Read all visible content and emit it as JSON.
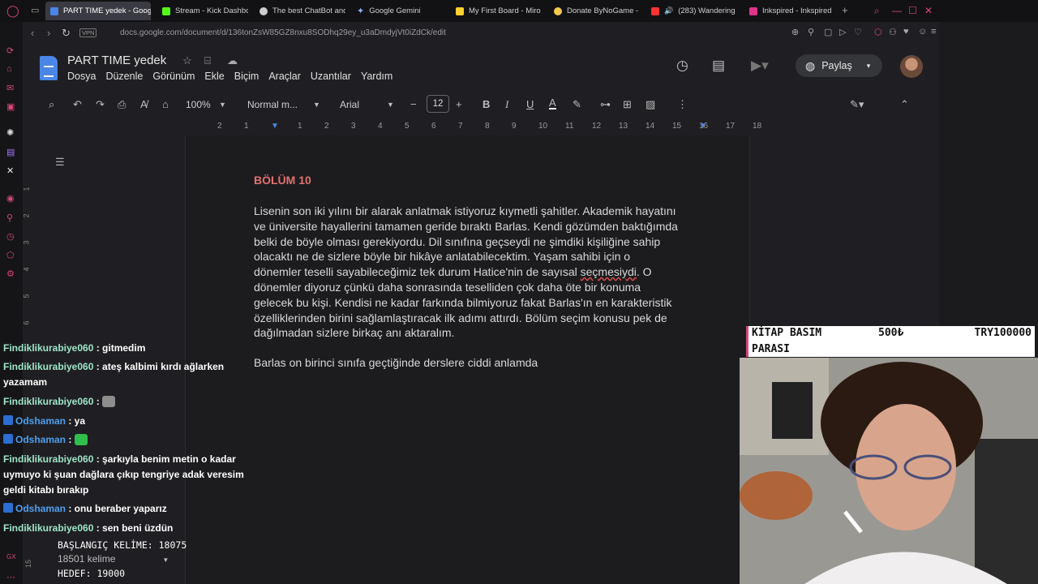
{
  "tabs": [
    {
      "label": "PART TIME yedek - Goog",
      "active": true,
      "color": "#4a86e8"
    },
    {
      "label": "Stream - Kick Dashbo",
      "active": false,
      "color": "#53fc18"
    },
    {
      "label": "The best ChatBot and",
      "active": false,
      "color": "#cccccc"
    },
    {
      "label": "Google Gemini",
      "active": false,
      "color": "#8ab4f8"
    },
    {
      "label": "My First Board - Miro",
      "active": false,
      "color": "#ffd02f"
    },
    {
      "label": "Donate ByNoGame - ",
      "active": false,
      "color": "#f2c94c"
    },
    {
      "label": "(283) Wandering",
      "active": false,
      "color": "#ff3333"
    },
    {
      "label": "Inkspired - Inkspired",
      "active": false,
      "color": "#e0348a"
    }
  ],
  "address": {
    "vpn": "VPN",
    "url": "docs.google.com/document/d/136tonZsW85GZ8nxu8SODhq29ey_u3aDmdyjVt0iZdCk/edit"
  },
  "docs": {
    "title": "PART TIME  yedek",
    "menu": [
      "Dosya",
      "Düzenle",
      "Görünüm",
      "Ekle",
      "Biçim",
      "Araçlar",
      "Uzantılar",
      "Yardım"
    ],
    "share_label": "Paylaş",
    "toolbar": {
      "zoom": "100%",
      "style": "Normal m...",
      "font": "Arial",
      "font_size": "12"
    },
    "ruler_numbers": [
      "2",
      "1",
      "",
      "1",
      "2",
      "3",
      "4",
      "5",
      "6",
      "7",
      "8",
      "9",
      "10",
      "11",
      "12",
      "13",
      "14",
      "15",
      "16",
      "17",
      "18"
    ],
    "vruler_numbers": [
      "1",
      "2",
      "3",
      "4",
      "5",
      "6",
      "15"
    ]
  },
  "document": {
    "chapter": "BÖLÜM 10",
    "paragraph1_lines": [
      "Lisenin son iki yılını bir alarak anlatmak istiyoruz kıymetli şahitler. Akademik hayatını",
      "ve üniversite hayallerini tamamen geride bıraktı Barlas. Kendi gözümden baktığımda",
      "belki de böyle olması gerekiyordu. Dil sınıfına geçseydi ne şimdiki kişiliğine sahip",
      "olacaktı ne de sizlere böyle bir hikâye anlatabilecektim. Yaşam sahibi için o",
      "dönemler teselli sayabileceğimiz tek durum Hatice'nin de sayısal ",
      "dönemler diyoruz çünkü daha sonrasında teselliden çok daha öte bir konuma",
      "gelecek bu kişi. Kendisi ne kadar farkında bilmiyoruz fakat Barlas'ın en karakteristik",
      "özelliklerinden birini sağlamlaştıracak ilk adımı attırdı. Bölüm seçim konusu pek de",
      "dağılmadan sizlere birkaç anı aktaralım."
    ],
    "misspelled": "seçmesiydi",
    "after_misspelled": ". O",
    "paragraph2": "Barlas on birinci sınıfa geçtiğinde derslere ciddi anlamda"
  },
  "chat": [
    {
      "user": "Findiklikurabiye060",
      "text": " : gitmedim",
      "style": "green",
      "badge": false
    },
    {
      "user": "Findiklikurabiye060",
      "text": " : ateş kalbimi kırdı ağlarken yazamam",
      "style": "green",
      "badge": false
    },
    {
      "user": "Findiklikurabiye060",
      "text": " : ",
      "style": "green",
      "badge": false,
      "emote": "cat-emote"
    },
    {
      "user": "Odshaman",
      "text": " : ya",
      "style": "blue",
      "badge": true
    },
    {
      "user": "Odshaman",
      "text": " : ",
      "style": "blue",
      "badge": true,
      "emote": "green-emote"
    },
    {
      "user": "Findiklikurabiye060",
      "text": " : şarkıyla benim metin o kadar uymuyo ki şuan dağlara çıkıp tengriye adak veresim geldi kitabı bırakıp",
      "style": "green",
      "badge": false
    },
    {
      "user": "Odshaman",
      "text": " : onu beraber yaparız",
      "style": "blue",
      "badge": true
    },
    {
      "user": "Findiklikurabiye060",
      "text": " : sen beni üzdün",
      "style": "green",
      "badge": false
    }
  ],
  "counter": {
    "start": "BAŞLANGIÇ KELİME: 18075",
    "word_count": "18501 kelime",
    "goal": "HEDEF: 19000"
  },
  "book_overlay": {
    "label_line1": "KİTAP BASIM",
    "label_line2": "PARASI",
    "current": "500₺",
    "target": "TRY100000"
  },
  "colors": {
    "accent": "#d8457a",
    "chapter_red": "#e3726e",
    "chat_green": "#9ee6c9",
    "chat_blue": "#4d9ff0"
  }
}
